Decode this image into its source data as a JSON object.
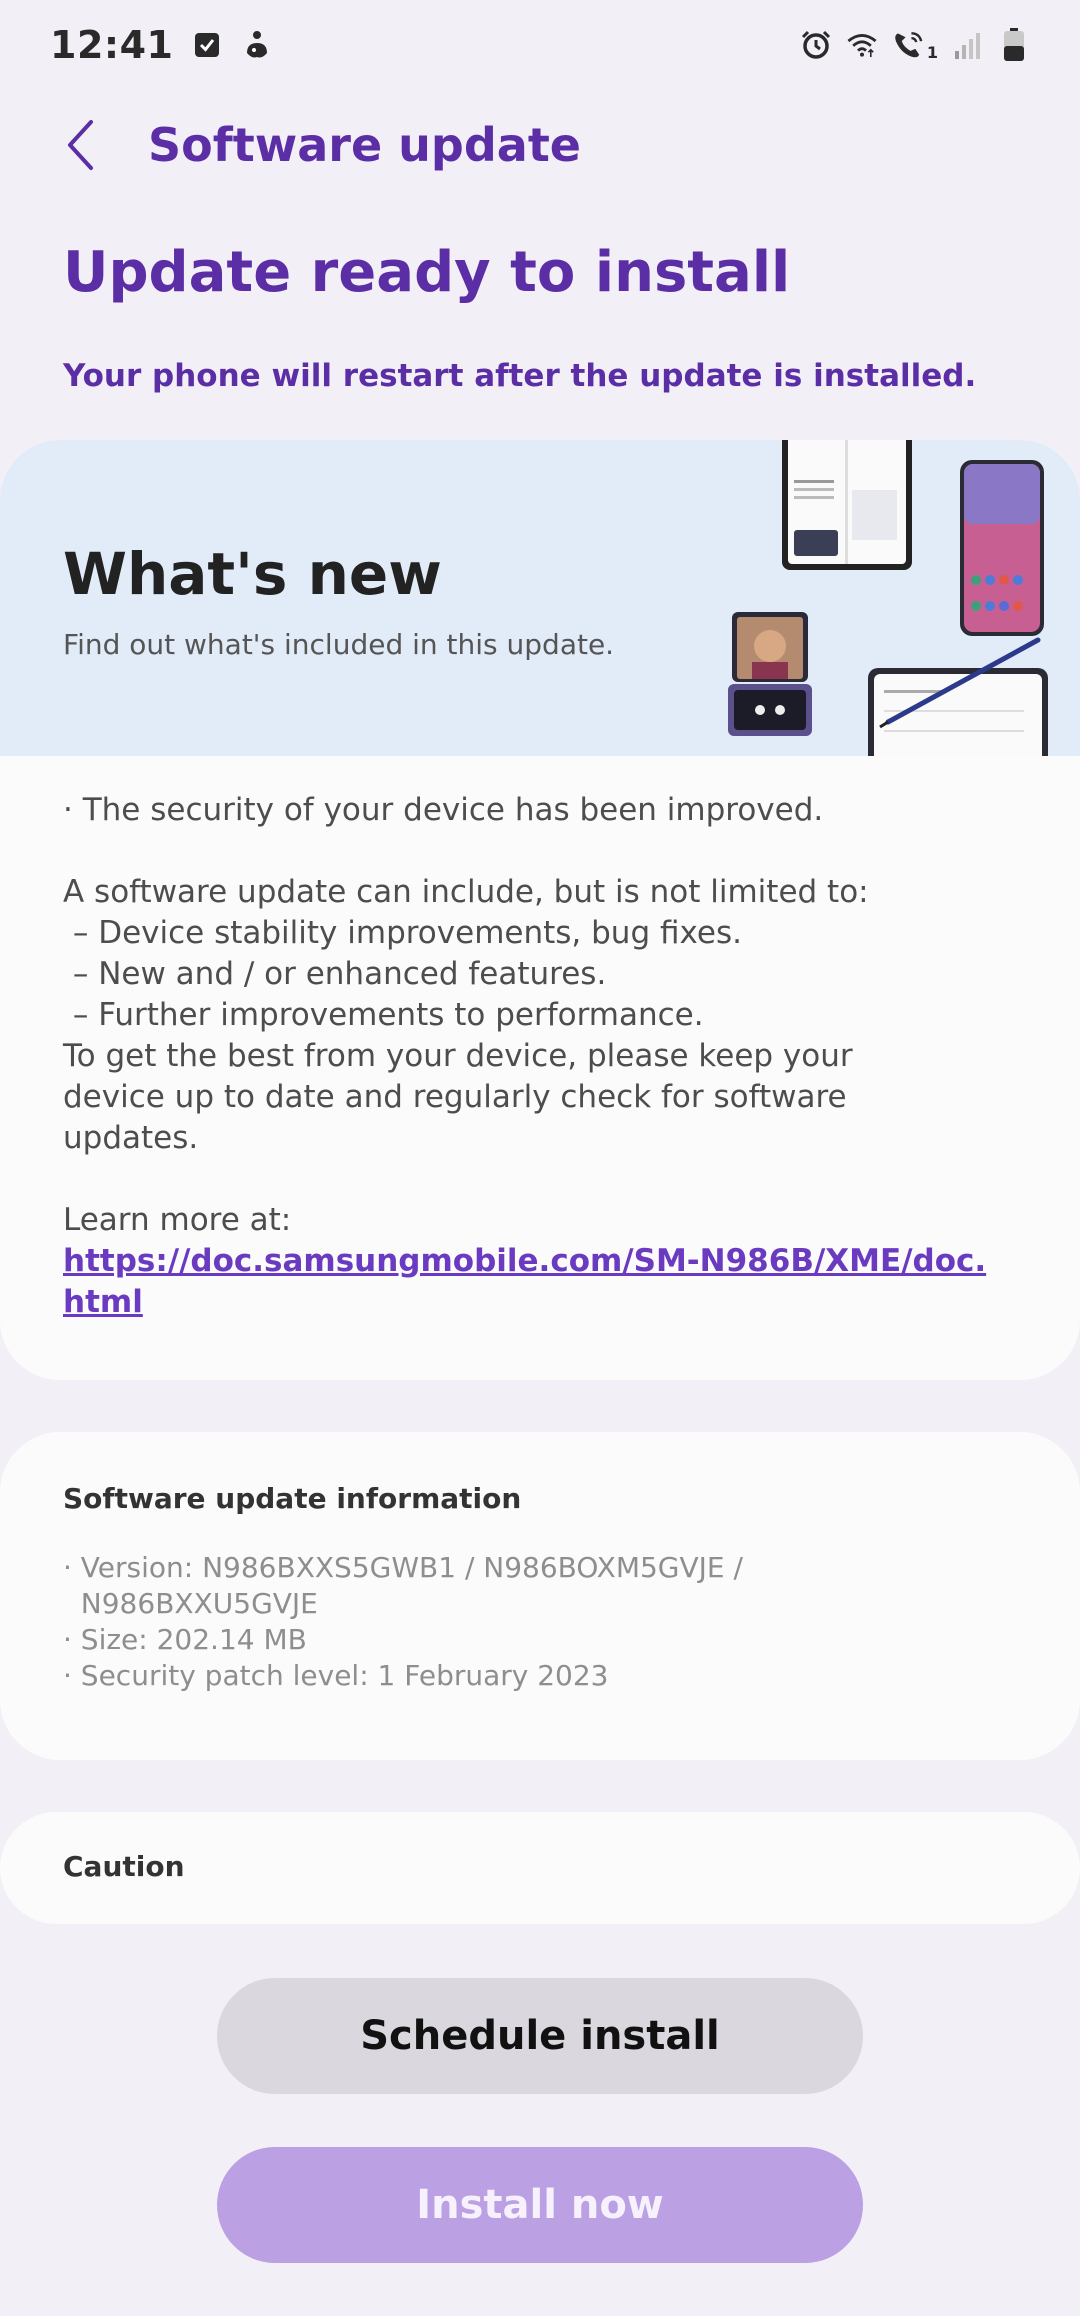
{
  "status_bar": {
    "time": "12:41",
    "left_icons": [
      "checkbox-icon",
      "accessibility-icon"
    ],
    "right_icons": [
      "alarm-icon",
      "wifi-icon",
      "wifi-calling-icon",
      "signal-icon",
      "battery-icon"
    ],
    "call_sim_label": "1"
  },
  "appbar": {
    "back_icon": "chevron-left-icon",
    "title": "Software update"
  },
  "headline": "Update ready to install",
  "subline": "Your phone will restart after the update is installed.",
  "whats_new": {
    "title": "What's new",
    "subtitle": "Find out what's included in this update.",
    "body_lines": [
      "· The security of your device has been improved.",
      "",
      "A software update can include, but is not limited to:",
      " – Device stability improvements, bug fixes.",
      " – New and / or enhanced features.",
      " – Further improvements to performance.",
      "To get the best from your device, please keep your",
      "device up to date and regularly check for software",
      "updates.",
      "",
      "Learn more at:"
    ],
    "link": "https://doc.samsungmobile.com/SM-N986B/XME/doc.html"
  },
  "info": {
    "title": "Software update information",
    "lines": [
      "· Version: N986BXXS5GWB1 / N986BOXM5GVJE /",
      "  N986BXXU5GVJE",
      "· Size: 202.14 MB",
      "· Security patch level: 1 February 2023"
    ]
  },
  "caution": {
    "title": "Caution"
  },
  "buttons": {
    "schedule": "Schedule install",
    "install": "Install now"
  },
  "colors": {
    "accent": "#5b2ea6",
    "background": "#f2f0f6",
    "banner": "#e2ecf8",
    "install_button": "#bba0e4",
    "schedule_button": "#dad8de"
  }
}
